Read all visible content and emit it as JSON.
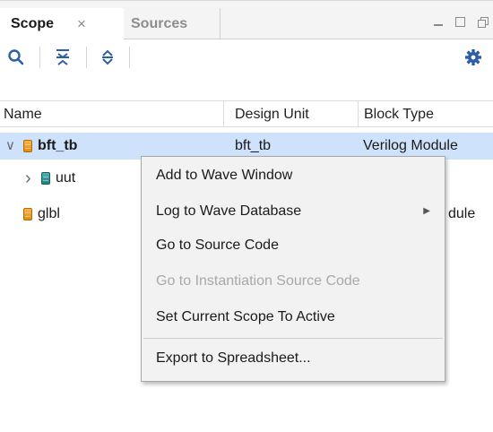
{
  "tabs": [
    {
      "label": "Scope",
      "close": "×"
    },
    {
      "label": "Sources"
    }
  ],
  "toolbar": {
    "icons": [
      "search-icon",
      "collapse-all-icon",
      "expand-all-icon",
      "gear-icon"
    ]
  },
  "table": {
    "columns": [
      "Name",
      "Design Unit",
      "Block Type"
    ],
    "rows": [
      {
        "name": "bft_tb",
        "design_unit": "bft_tb",
        "block_type": "Verilog Module",
        "expand": "∨",
        "icon": "module-icon-orange",
        "selected": true
      },
      {
        "name": "uut",
        "design_unit": "",
        "block_type": "ty",
        "expand": "›",
        "icon": "module-icon-teal",
        "selected": false
      },
      {
        "name": "glbl",
        "design_unit": "",
        "block_type": "dule",
        "expand": "",
        "icon": "module-icon-orange",
        "selected": false
      }
    ]
  },
  "context_menu": {
    "items": [
      {
        "label": "Add to Wave Window"
      },
      {
        "label": "Log to Wave Database",
        "submenu_arrow": "▶"
      },
      {
        "label": "Go to Source Code"
      },
      {
        "label": "Go to Instantiation Source Code",
        "disabled": true
      },
      {
        "label": "Set Current Scope To Active"
      },
      {
        "label": "Export to Spreadsheet..."
      }
    ]
  },
  "colors": {
    "selection": "#cfe2fb",
    "accent_icon": "#2b5fa8",
    "module_orange": "#e48a10",
    "module_teal": "#1e7f7e"
  }
}
